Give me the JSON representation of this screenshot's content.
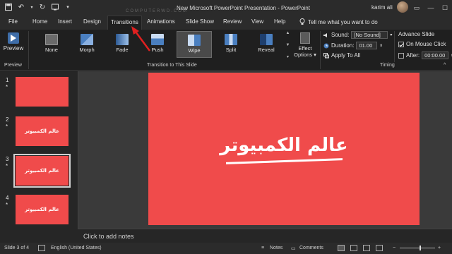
{
  "titlebar": {
    "title": "New Microsoft PowerPoint Presentation  -  PowerPoint",
    "user": "karim ali",
    "watermark": "COMPUTERWD.COM"
  },
  "tabs": [
    {
      "label": "File"
    },
    {
      "label": "Home"
    },
    {
      "label": "Insert"
    },
    {
      "label": "Design"
    },
    {
      "label": "Transitions"
    },
    {
      "label": "Animations"
    },
    {
      "label": "Slide Show"
    },
    {
      "label": "Review"
    },
    {
      "label": "View"
    },
    {
      "label": "Help"
    }
  ],
  "active_tab": "Transitions",
  "tellme": "Tell me what you want to do",
  "ribbon": {
    "preview_label": "Preview",
    "preview_group": "Preview",
    "transitions_group": "Transition to This Slide",
    "transitions": [
      {
        "label": "None"
      },
      {
        "label": "Morph"
      },
      {
        "label": "Fade"
      },
      {
        "label": "Push"
      },
      {
        "label": "Wipe"
      },
      {
        "label": "Split"
      },
      {
        "label": "Reveal"
      }
    ],
    "selected_transition": "Wipe",
    "effect_label_1": "Effect",
    "effect_label_2": "Options",
    "timing_group": "Timing",
    "sound_label": "Sound:",
    "sound_value": "[No Sound]",
    "duration_label": "Duration:",
    "duration_value": "01.00",
    "apply_all": "Apply To All",
    "advance_title": "Advance Slide",
    "on_click_label": "On Mouse Click",
    "on_click_checked": true,
    "after_label": "After:",
    "after_checked": false,
    "after_value": "00:00.00"
  },
  "slides": [
    {
      "num": "1",
      "star": "*",
      "text": ""
    },
    {
      "num": "2",
      "star": "*",
      "text": "عالم الكمبيوتر"
    },
    {
      "num": "3",
      "star": "*",
      "text": "عالم الكمبيوتر"
    },
    {
      "num": "4",
      "star": "*",
      "text": "عالم الكمبيوتر"
    }
  ],
  "current_slide_text": "عالم الكمبيوتر",
  "notes_placeholder": "Click to add notes",
  "status": {
    "slide_of": "Slide 3 of 4",
    "language": "English (United States)",
    "notes": "Notes",
    "comments": "Comments"
  },
  "colors": {
    "slide_bg": "#f04b4b",
    "annotation_arrow": "#e02020"
  }
}
